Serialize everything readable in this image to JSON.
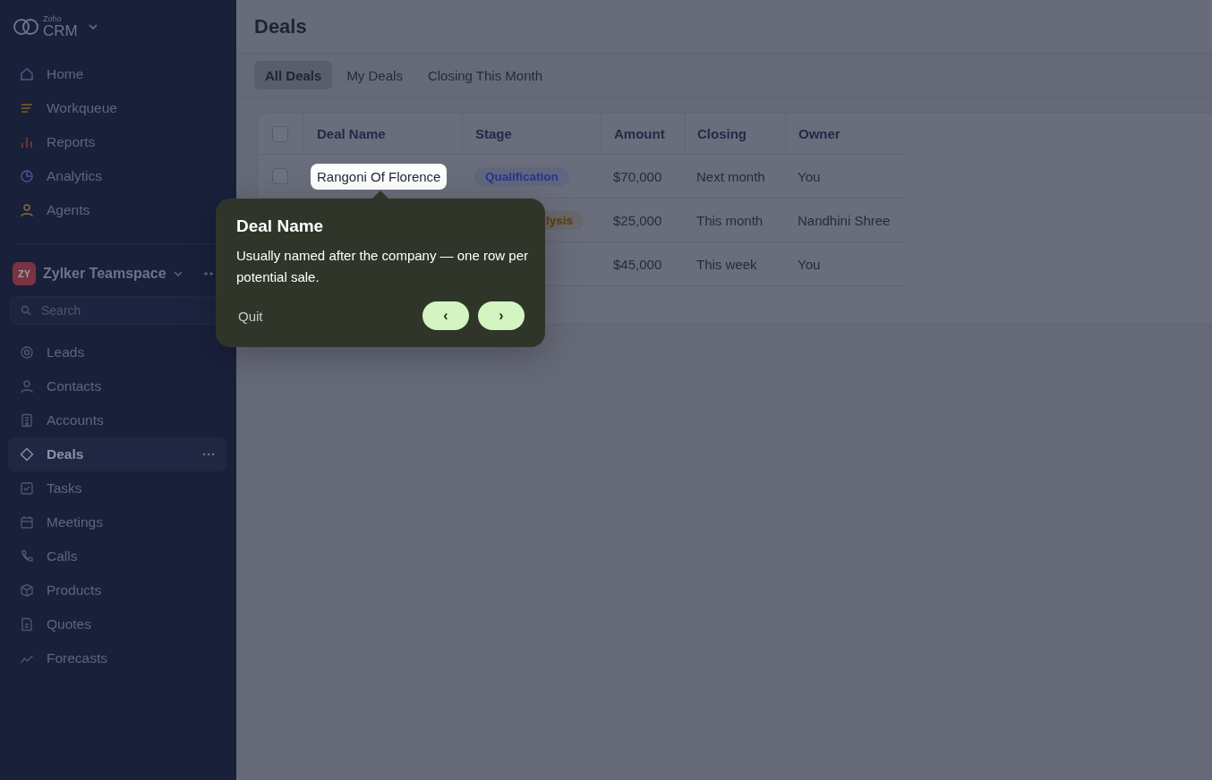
{
  "sidebar": {
    "logo": {
      "small": "Zoho",
      "big": "CRM"
    },
    "top_items": [
      {
        "label": "Home",
        "selected": false
      },
      {
        "label": "Workqueue",
        "selected": false
      },
      {
        "label": "Reports",
        "selected": false
      },
      {
        "label": "Analytics",
        "selected": false
      },
      {
        "label": "Agents",
        "selected": false
      }
    ],
    "teamspace": {
      "initials": "ZY",
      "name": "Zylker Teamspace"
    },
    "search": {
      "placeholder": "Search"
    },
    "items": [
      {
        "label": "Leads",
        "selected": false
      },
      {
        "label": "Contacts",
        "selected": false
      },
      {
        "label": "Accounts",
        "selected": false
      },
      {
        "label": "Deals",
        "selected": true
      },
      {
        "label": "Tasks",
        "selected": false
      },
      {
        "label": "Meetings",
        "selected": false
      },
      {
        "label": "Calls",
        "selected": false
      },
      {
        "label": "Products",
        "selected": false
      },
      {
        "label": "Quotes",
        "selected": false
      },
      {
        "label": "Forecasts",
        "selected": false
      }
    ]
  },
  "page": {
    "title": "Deals"
  },
  "tabs": [
    {
      "label": "All Deals",
      "selected": true
    },
    {
      "label": "My Deals",
      "selected": false
    },
    {
      "label": "Closing This Month",
      "selected": false
    }
  ],
  "table": {
    "select_all": {
      "checked": false
    },
    "columns": [
      "Deal Name",
      "Stage",
      "Amount",
      "Closing",
      "Owner"
    ],
    "rows": [
      {
        "checked": false,
        "deal_name": "Rangoni Of Florence",
        "highlighted": true,
        "stage": "Qualification",
        "color": "#27358f",
        "amount": "$70,000",
        "closing": "Next month",
        "owner": "You"
      },
      {
        "stage": "lysis",
        "color": "#5e3c02",
        "amount": "$25,000",
        "closing": "This month",
        "owner": "Nandhini Shree"
      },
      {
        "amount": "$45,000",
        "closing": "This week",
        "owner": "You"
      }
    ]
  },
  "tour": {
    "title": "Deal Name",
    "body": "Usually named after the company — one row per potential sale.",
    "quit": "Quit",
    "prev": "‹",
    "next": "›"
  }
}
